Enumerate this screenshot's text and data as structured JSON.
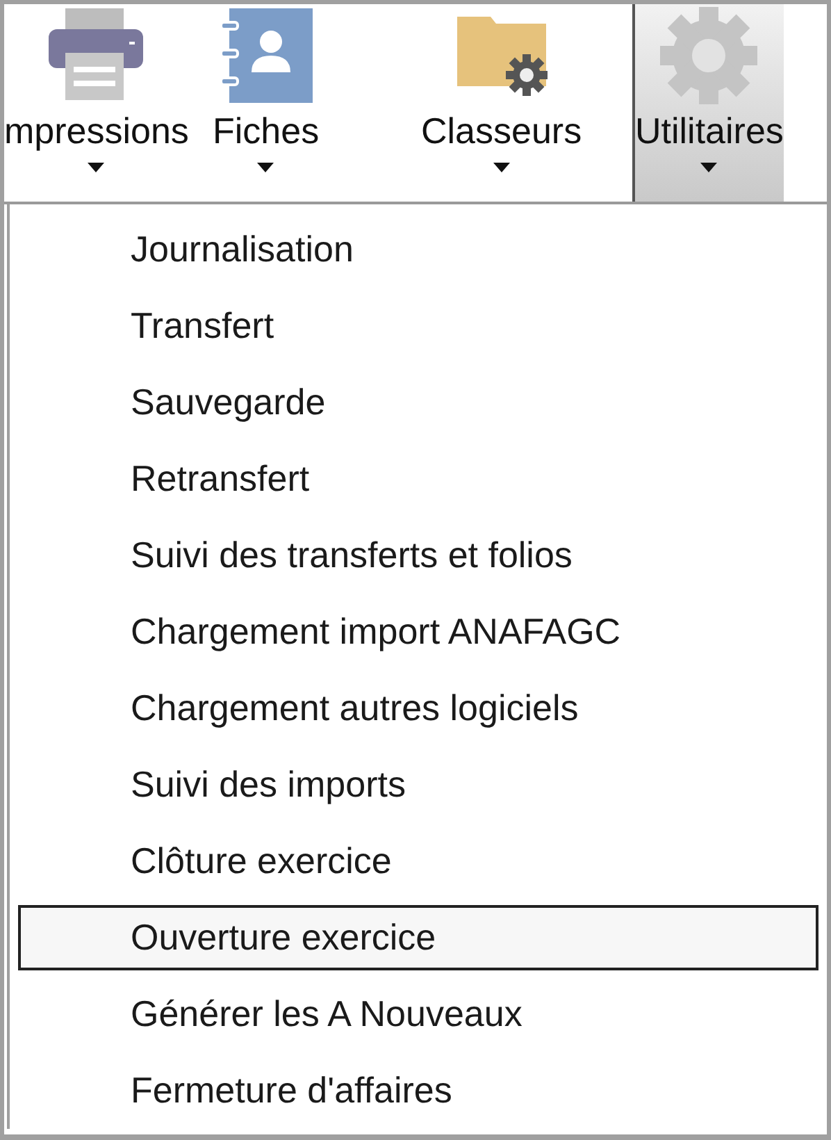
{
  "toolbar": [
    {
      "label": "mpressions",
      "selected": false
    },
    {
      "label": "Fiches",
      "selected": false
    },
    {
      "label": "Classeurs",
      "selected": false
    },
    {
      "label": "Utilitaires",
      "selected": true
    }
  ],
  "menu": {
    "items": [
      {
        "label": "Journalisation",
        "selected": false
      },
      {
        "label": "Transfert",
        "selected": false
      },
      {
        "label": "Sauvegarde",
        "selected": false
      },
      {
        "label": "Retransfert",
        "selected": false
      },
      {
        "label": "Suivi des transferts et folios",
        "selected": false
      },
      {
        "label": "Chargement import ANAFAGC",
        "selected": false
      },
      {
        "label": "Chargement autres logiciels",
        "selected": false
      },
      {
        "label": "Suivi des imports",
        "selected": false
      },
      {
        "label": "Clôture exercice",
        "selected": false
      },
      {
        "label": "Ouverture exercice",
        "selected": true
      },
      {
        "label": "Générer les A Nouveaux",
        "selected": false
      },
      {
        "label": "Fermeture d'affaires",
        "selected": false
      }
    ]
  }
}
